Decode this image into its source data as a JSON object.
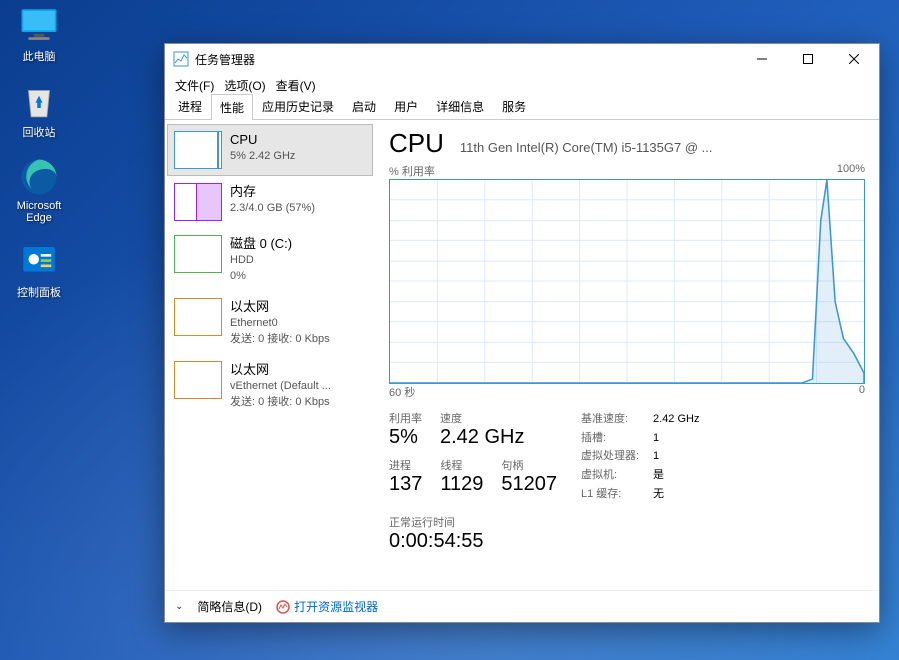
{
  "desktop": {
    "items": [
      {
        "label": "此电脑"
      },
      {
        "label": "回收站"
      },
      {
        "label": "Microsoft Edge"
      },
      {
        "label": "控制面板"
      }
    ]
  },
  "window": {
    "title": "任务管理器",
    "menus": [
      "文件(F)",
      "选项(O)",
      "查看(V)"
    ],
    "tabs": [
      "进程",
      "性能",
      "应用历史记录",
      "启动",
      "用户",
      "详细信息",
      "服务"
    ],
    "activeTab": 1
  },
  "sidebar": {
    "items": [
      {
        "title": "CPU",
        "line2": "5% 2.42 GHz",
        "color": "#3b96d4"
      },
      {
        "title": "内存",
        "line2": "2.3/4.0 GB (57%)",
        "color": "#a020f0"
      },
      {
        "title": "磁盘 0 (C:)",
        "line2": "HDD",
        "line3": "0%",
        "color": "#4db34d"
      },
      {
        "title": "以太网",
        "line2": "Ethernet0",
        "line3": "发送: 0 接收: 0 Kbps",
        "color": "#d48b2a"
      },
      {
        "title": "以太网",
        "line2": "vEthernet (Default ...",
        "line3": "发送: 0 接收: 0 Kbps",
        "color": "#d48b2a"
      }
    ]
  },
  "cpu": {
    "heading": "CPU",
    "model": "11th Gen Intel(R) Core(TM) i5-1135G7 @ ...",
    "chartTopLeft": "% 利用率",
    "chartTopRight": "100%",
    "chartBottomLeft": "60 秒",
    "chartBottomRight": "0",
    "stats": {
      "util_lbl": "利用率",
      "util": "5%",
      "speed_lbl": "速度",
      "speed": "2.42 GHz",
      "proc_lbl": "进程",
      "proc": "137",
      "thr_lbl": "线程",
      "thr": "1129",
      "hnd_lbl": "句柄",
      "hnd": "51207"
    },
    "meta": {
      "base_lbl": "基准速度:",
      "base": "2.42 GHz",
      "sock_lbl": "插槽:",
      "sock": "1",
      "vproc_lbl": "虚拟处理器:",
      "vproc": "1",
      "vm_lbl": "虚拟机:",
      "vm": "是",
      "l1_lbl": "L1 缓存:",
      "l1": "无"
    },
    "uptime_lbl": "正常运行时间",
    "uptime": "0:00:54:55"
  },
  "footer": {
    "fewer": "简略信息(D)",
    "resmon": "打开资源监视器"
  },
  "chart_data": {
    "type": "line",
    "title": "% 利用率",
    "xlabel": "60 秒 → 0",
    "ylabel": "% 利用率",
    "ylim": [
      0,
      100
    ],
    "x_seconds_ago": [
      60,
      55,
      50,
      45,
      40,
      35,
      30,
      25,
      20,
      15,
      10,
      8,
      7,
      6,
      5,
      4,
      3,
      2,
      1,
      0
    ],
    "values": [
      0,
      0,
      0,
      0,
      0,
      0,
      0,
      0,
      0,
      0,
      0,
      0,
      0,
      2,
      80,
      100,
      40,
      22,
      15,
      5
    ]
  }
}
